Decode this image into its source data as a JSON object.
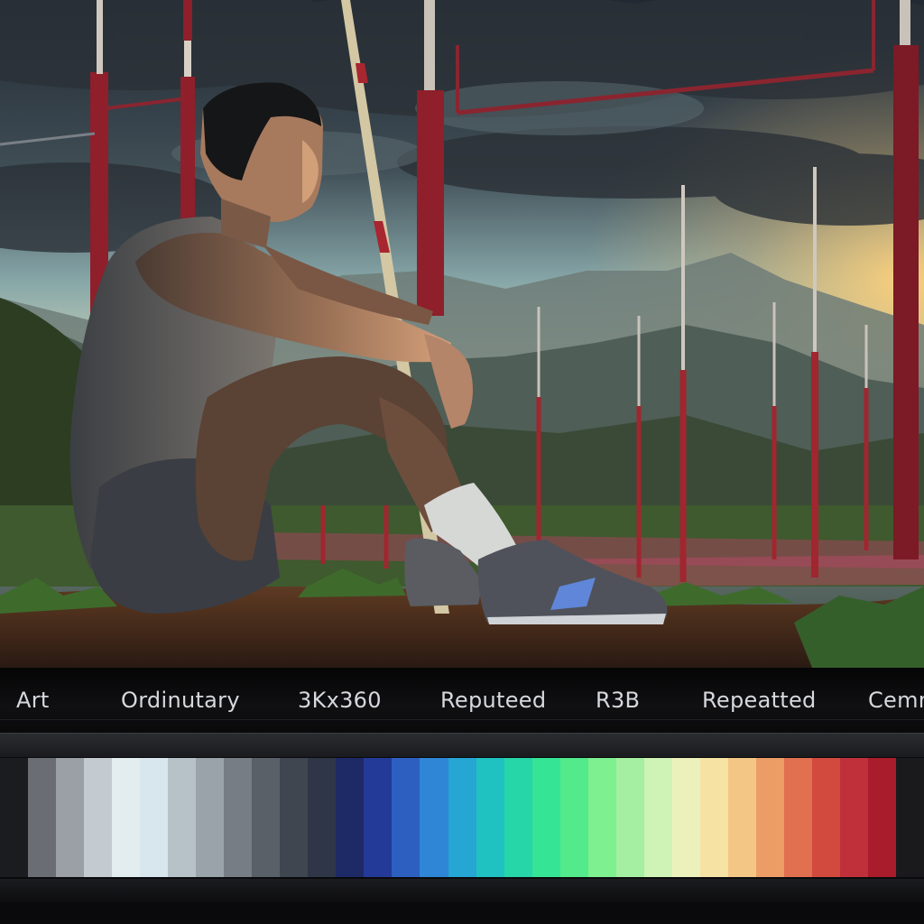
{
  "labels": [
    "Art",
    "Ordinutary",
    "3Kx360",
    "Reputeed",
    "R3B",
    "Repeatted",
    "Cemm"
  ],
  "palette": [
    "#1a1c20",
    "#6a6e74",
    "#9aa0a6",
    "#c4cbd0",
    "#e3ecef",
    "#d8e6ee",
    "#b7c2c8",
    "#9aa3aa",
    "#767d84",
    "#5a6068",
    "#404650",
    "#2e3648",
    "#1e2a66",
    "#243a98",
    "#2c5fc0",
    "#2f86d6",
    "#25a6d3",
    "#1fc2c0",
    "#26d6a8",
    "#36e496",
    "#52ea8a",
    "#7ef090",
    "#a5efa2",
    "#cff3b6",
    "#ecf1bc",
    "#f6e3a4",
    "#f4c685",
    "#ec9d66",
    "#e07050",
    "#d24a3e",
    "#c0303a",
    "#a81c2c",
    "#1a1a1c"
  ]
}
